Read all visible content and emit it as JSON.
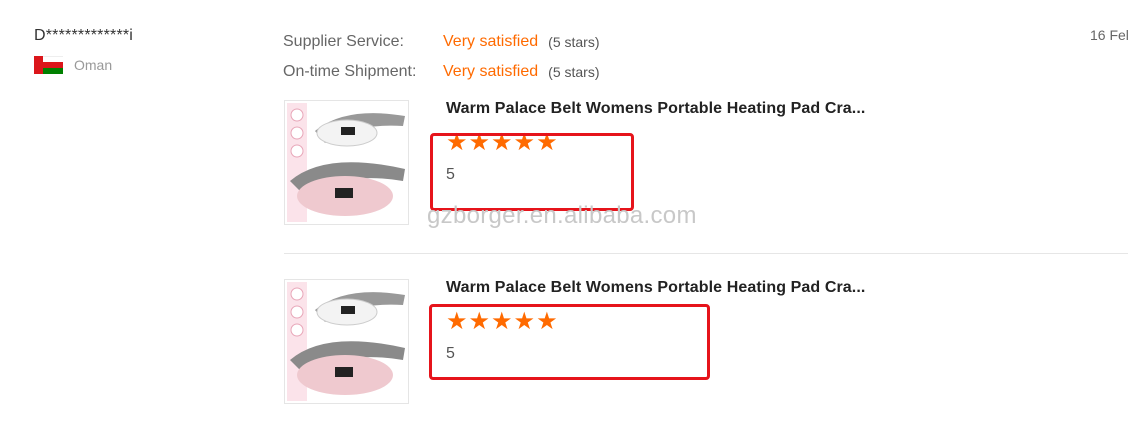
{
  "reviewer": {
    "name": "D*************i",
    "country": "Oman",
    "flag_icon": "oman-flag-icon"
  },
  "ratings": [
    {
      "label": "Supplier Service:",
      "value": "Very satisfied",
      "stars": "(5 stars)"
    },
    {
      "label": "On-time Shipment:",
      "value": "Very satisfied",
      "stars": "(5 stars)"
    }
  ],
  "date": "16 Fel",
  "products": [
    {
      "title": "Warm Palace Belt Womens Portable Heating Pad Cra...",
      "rating": 5,
      "score": "5",
      "star_glyph": "★"
    },
    {
      "title": "Warm Palace Belt Womens Portable Heating Pad Cra...",
      "rating": 5,
      "score": "5",
      "star_glyph": "★"
    }
  ],
  "watermark": "gzborger.en.alibaba.com",
  "colors": {
    "accent": "#ff6a00",
    "highlight": "#e6141b"
  }
}
